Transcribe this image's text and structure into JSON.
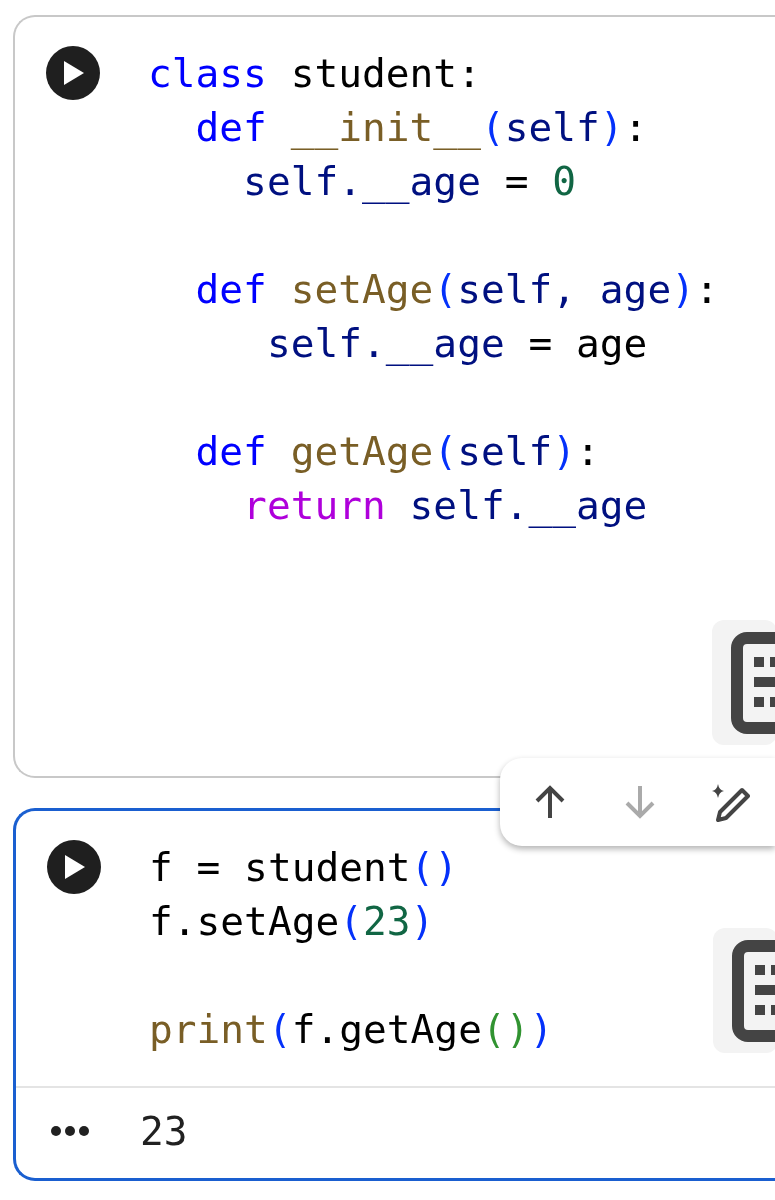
{
  "cells": [
    {
      "selected": false,
      "lines": [
        {
          "kind": "code",
          "tokens": [
            {
              "kind": "keyword",
              "text": "class"
            },
            {
              "kind": "plain",
              "text": " student:"
            }
          ]
        },
        {
          "kind": "code",
          "tokens": [
            {
              "kind": "keyword",
              "text": "  def"
            },
            {
              "kind": "function",
              "text": " __init__"
            },
            {
              "kind": "paren",
              "text": "("
            },
            {
              "kind": "variable",
              "text": "self"
            },
            {
              "kind": "paren",
              "text": ")"
            },
            {
              "kind": "plain",
              "text": ":"
            }
          ]
        },
        {
          "kind": "code",
          "tokens": [
            {
              "kind": "variable",
              "text": "    self.__age"
            },
            {
              "kind": "plain",
              "text": " = "
            },
            {
              "kind": "number",
              "text": "0"
            }
          ]
        },
        {
          "kind": "blank"
        },
        {
          "kind": "code",
          "tokens": [
            {
              "kind": "keyword",
              "text": "  def"
            },
            {
              "kind": "function",
              "text": " setAge"
            },
            {
              "kind": "paren",
              "text": "("
            },
            {
              "kind": "variable",
              "text": "self, age"
            },
            {
              "kind": "paren",
              "text": ")"
            },
            {
              "kind": "plain",
              "text": ":"
            }
          ]
        },
        {
          "kind": "code",
          "tokens": [
            {
              "kind": "variable",
              "text": "     self.__age"
            },
            {
              "kind": "plain",
              "text": " = age"
            }
          ]
        },
        {
          "kind": "blank"
        },
        {
          "kind": "code",
          "tokens": [
            {
              "kind": "keyword",
              "text": "  def"
            },
            {
              "kind": "function",
              "text": " getAge"
            },
            {
              "kind": "paren",
              "text": "("
            },
            {
              "kind": "variable",
              "text": "self"
            },
            {
              "kind": "paren",
              "text": ")"
            },
            {
              "kind": "plain",
              "text": ":"
            }
          ]
        },
        {
          "kind": "code",
          "tokens": [
            {
              "kind": "control",
              "text": "    return"
            },
            {
              "kind": "variable",
              "text": " self.__age"
            }
          ]
        }
      ]
    },
    {
      "selected": true,
      "lines": [
        {
          "kind": "code",
          "tokens": [
            {
              "kind": "plain",
              "text": "f = student"
            },
            {
              "kind": "paren",
              "text": "()"
            }
          ]
        },
        {
          "kind": "code",
          "tokens": [
            {
              "kind": "plain",
              "text": "f.setAge"
            },
            {
              "kind": "paren",
              "text": "("
            },
            {
              "kind": "number",
              "text": "23"
            },
            {
              "kind": "paren",
              "text": ")"
            }
          ]
        },
        {
          "kind": "blank"
        },
        {
          "kind": "code",
          "tokens": [
            {
              "kind": "function",
              "text": "print"
            },
            {
              "kind": "paren",
              "text": "("
            },
            {
              "kind": "plain",
              "text": "f.getAge"
            },
            {
              "kind": "paren2",
              "text": "()"
            },
            {
              "kind": "paren",
              "text": ")"
            }
          ]
        }
      ],
      "output": "23"
    }
  ],
  "cell_toolbar": {
    "buttons": [
      {
        "kind": "move-up",
        "disabled": false
      },
      {
        "kind": "move-down",
        "disabled": true
      },
      {
        "kind": "ai-edit",
        "disabled": false
      }
    ]
  }
}
